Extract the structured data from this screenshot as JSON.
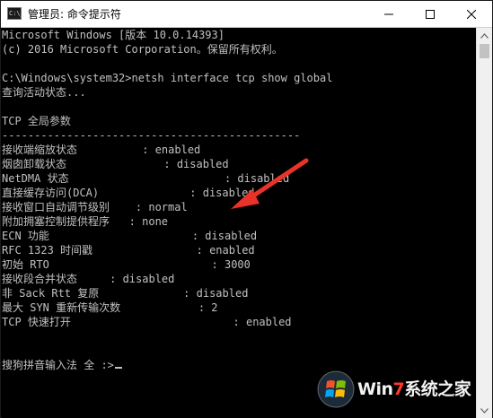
{
  "window": {
    "title": "管理员: 命令提示符",
    "icon": "cmd-app-icon",
    "icon_text": "C:\\_",
    "controls": [
      "minimize-icon",
      "maximize-icon",
      "close-icon"
    ]
  },
  "console": {
    "lines": [
      "Microsoft Windows [版本 10.0.14393]",
      "(c) 2016 Microsoft Corporation。保留所有权利。",
      "",
      "C:\\Windows\\system32>netsh interface tcp show global",
      "查询活动状态...",
      "",
      "TCP 全局参数",
      "----------------------------------------------",
      "接收端缩放状态          : enabled",
      "烟囱卸载状态               : disabled",
      "NetDMA 状态                        : disabled",
      "直接缓存访问(DCA)              : disabled",
      "接收窗口自动调节级别    : normal",
      "附加拥塞控制提供程序   : none",
      "ECN 功能                      : disabled",
      "RFC 1323 时间戳                : enabled",
      "初始 RTO                         : 3000",
      "接收段合并状态     : disabled",
      "非 Sack Rtt 复原             : disabled",
      "最大 SYN 重新传输次数            : 2",
      "TCP 快速打开                         : enabled",
      "",
      "",
      "搜狗拼音输入法 全 :>"
    ]
  },
  "annotation": {
    "arrow_color": "#e8322a"
  },
  "watermark": {
    "brand_prefix": "Win",
    "brand_seven": "7",
    "brand_suffix": "系统之家",
    "logo": "windows-logo-icon"
  },
  "colors": {
    "console_bg": "#000000",
    "console_text": "#c0c0c0",
    "titlebar_bg": "#ffffff"
  }
}
